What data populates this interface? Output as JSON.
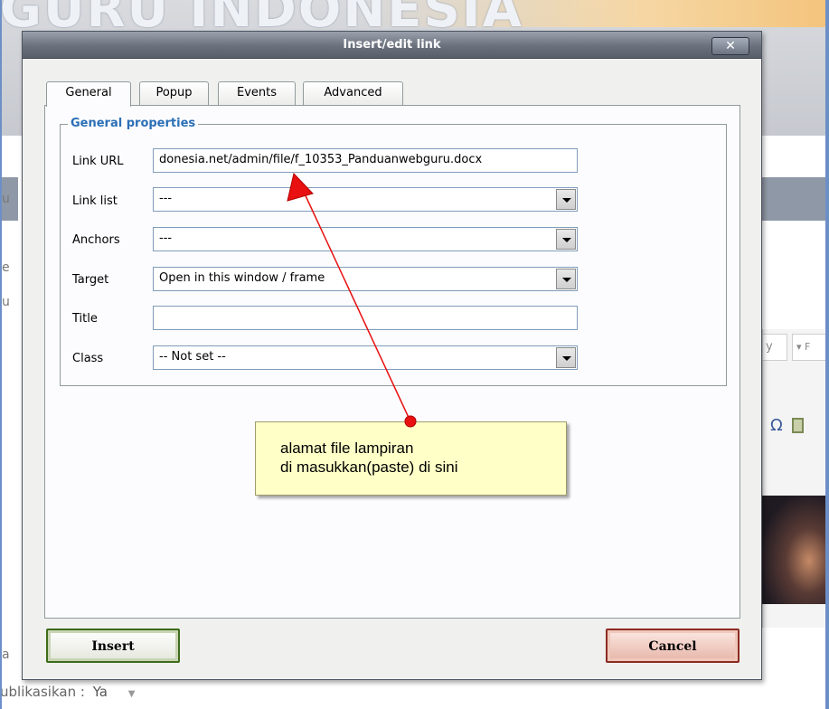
{
  "background": {
    "banner_title": "GURU INDONESIA",
    "publish_label": "ublikasikan :",
    "publish_value": "Ya",
    "left_fragments": [
      "u",
      "e",
      "u",
      "a"
    ]
  },
  "dialog": {
    "title": "Insert/edit link",
    "close_glyph": "✕",
    "tabs": [
      {
        "label": "General",
        "active": true
      },
      {
        "label": "Popup",
        "active": false
      },
      {
        "label": "Events",
        "active": false
      },
      {
        "label": "Advanced",
        "active": false
      }
    ],
    "legend": "General properties",
    "fields": {
      "link_url": {
        "label": "Link URL",
        "value": "donesia.net/admin/file/f_10353_Panduanwebguru.docx"
      },
      "link_list": {
        "label": "Link list",
        "value": "---"
      },
      "anchors": {
        "label": "Anchors",
        "value": "---"
      },
      "target": {
        "label": "Target",
        "value": "Open in this window / frame"
      },
      "title": {
        "label": "Title",
        "value": ""
      },
      "class": {
        "label": "Class",
        "value": "-- Not set --"
      }
    },
    "insert_label": "Insert",
    "cancel_label": "Cancel"
  },
  "annotation": {
    "line1": "alamat file lampiran",
    "line2": "di masukkan(paste) di sini",
    "arrow_color": "#e81010"
  }
}
